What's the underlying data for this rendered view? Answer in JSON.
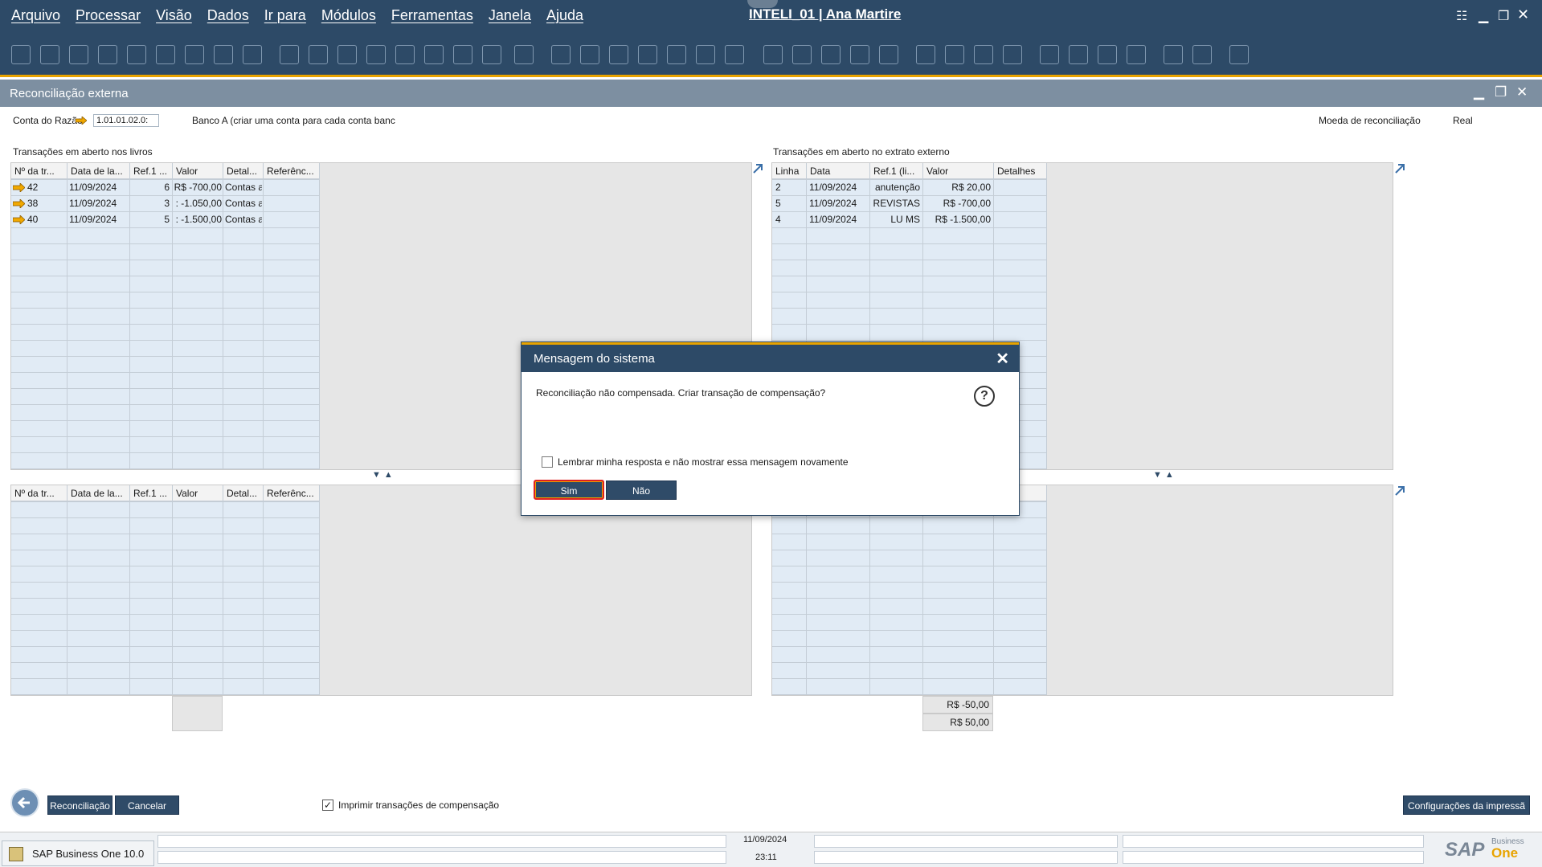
{
  "menu": {
    "items": [
      "Arquivo",
      "Processar",
      "Visão",
      "Dados",
      "Ir para",
      "Módulos",
      "Ferramentas",
      "Janela",
      "Ajuda"
    ],
    "session": "INTELI_01 | Ana Martire"
  },
  "window": {
    "title": "Reconciliação externa"
  },
  "header": {
    "account_label": "Conta do Razão",
    "account_value": "1.01.01.02.0:",
    "account_desc": "Banco A (criar uma conta para cada conta banc",
    "currency_label": "Moeda de reconciliação",
    "currency_value": "Real"
  },
  "books": {
    "title": "Transações em aberto nos livros",
    "columns": [
      "Nº da tr...",
      "Data de la...",
      "Ref.1 ...",
      "Valor",
      "Detal...",
      "Referênc..."
    ],
    "rows": [
      {
        "no": "42",
        "date": "11/09/2024",
        "ref1": "6",
        "value": "R$ -700,00",
        "details": "Contas a"
      },
      {
        "no": "38",
        "date": "11/09/2024",
        "ref1": "3",
        "value": ": -1.050,00",
        "details": "Contas a"
      },
      {
        "no": "40",
        "date": "11/09/2024",
        "ref1": "5",
        "value": ": -1.500,00",
        "details": "Contas a"
      }
    ]
  },
  "statement": {
    "title": "Transações em aberto no extrato externo",
    "columns": [
      "Linha",
      "Data",
      "Ref.1 (li...",
      "Valor",
      "Detalhes"
    ],
    "rows": [
      {
        "line": "2",
        "date": "11/09/2024",
        "ref1": "anutenção",
        "value": "R$ 20,00"
      },
      {
        "line": "5",
        "date": "11/09/2024",
        "ref1": "REVISTAS",
        "value": "R$ -700,00"
      },
      {
        "line": "4",
        "date": "11/09/2024",
        "ref1": "LU MS",
        "value": "R$ -1.500,00"
      }
    ]
  },
  "bottom_left": {
    "columns": [
      "Nº da tr...",
      "Data de la...",
      "Ref.1 ...",
      "Valor",
      "Detal...",
      "Referênc..."
    ]
  },
  "bottom_right": {
    "partial_header": "lhes",
    "total_1": "R$ -50,00",
    "total_2": "R$ 50,00"
  },
  "footer": {
    "reconcile_button": "Reconciliação",
    "cancel_button": "Cancelar",
    "print_checkbox_label": "Imprimir transações de compensação",
    "print_checked": true,
    "print_settings_button": "Configurações da impressã"
  },
  "statusbar": {
    "date": "11/09/2024",
    "time": "23:11",
    "task_label": "SAP Business One 10.0",
    "logo_text": "SAP",
    "logo_sub1": "Business",
    "logo_sub2": "One"
  },
  "dialog": {
    "title": "Mensagem do sistema",
    "message": "Reconciliação não compensada. Criar transação de compensação?",
    "remember_label": "Lembrar minha resposta e não mostrar essa mensagem novamente",
    "remember_checked": false,
    "yes_button": "Sim",
    "no_button": "Não"
  },
  "colors": {
    "header_bar": "#2d4a67",
    "accent": "#e8a300",
    "title_bar": "#7d8fa1",
    "grid_column": "#e1ebf5",
    "focus_outline": "#e02020"
  }
}
